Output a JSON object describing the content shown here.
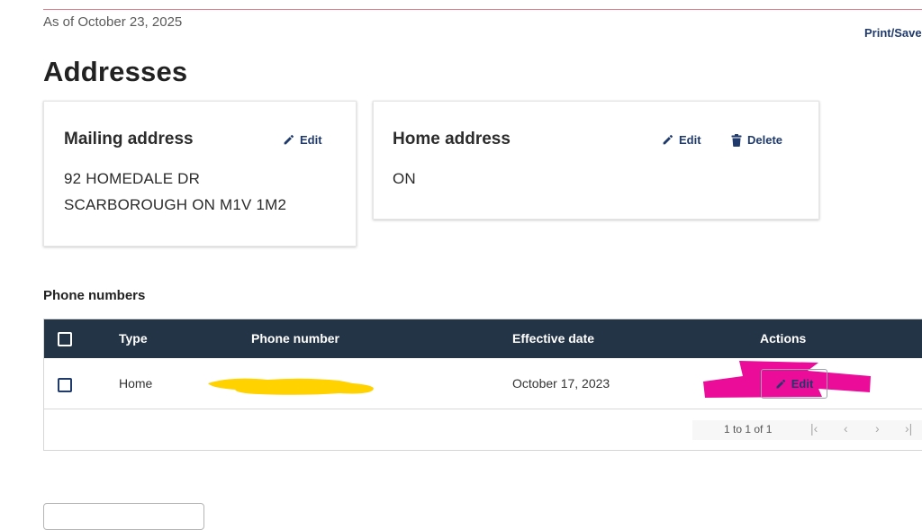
{
  "header": {
    "as_of": "As of October 23, 2025",
    "print_save": "Print/Save"
  },
  "page_title": "Addresses",
  "mailing_card": {
    "title": "Mailing address",
    "edit_label": "Edit",
    "line1": "92 HOMEDALE DR",
    "line2": "SCARBOROUGH ON M1V 1M2"
  },
  "home_card": {
    "title": "Home address",
    "edit_label": "Edit",
    "delete_label": "Delete",
    "line1": "ON"
  },
  "phones": {
    "section_title": "Phone numbers",
    "columns": [
      "Type",
      "Phone number",
      "Effective date",
      "Actions"
    ],
    "rows": [
      {
        "type": "Home",
        "phone_number": "",
        "effective_date": "October 17, 2023",
        "action_label": "Edit"
      }
    ],
    "pager_text": "1 to 1 of 1"
  },
  "colors": {
    "accent": "#1f3a6b",
    "table_header": "#243447",
    "redaction_yellow": "#ffd200",
    "redaction_magenta": "#ec0c9a"
  },
  "icons": [
    "pencil-icon",
    "trash-icon",
    "checkbox",
    "first-page-icon",
    "prev-page-icon",
    "next-page-icon",
    "last-page-icon"
  ]
}
